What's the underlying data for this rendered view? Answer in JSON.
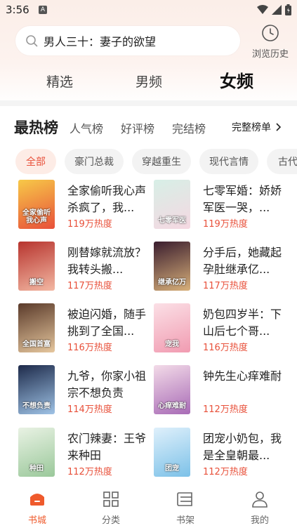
{
  "status": {
    "time": "3:56",
    "notif_badge": "A"
  },
  "search": {
    "query": "男人三十：妻子的欲望"
  },
  "history": {
    "label": "浏览历史"
  },
  "tabs": [
    {
      "label": "精选"
    },
    {
      "label": "男频"
    },
    {
      "label": "女频"
    }
  ],
  "ranking": {
    "title": "最热榜",
    "tabs": [
      "人气榜",
      "好评榜",
      "完结榜"
    ],
    "full_list_label": "完整榜单"
  },
  "chips": [
    "全部",
    "豪门总裁",
    "穿越重生",
    "现代言情",
    "古代"
  ],
  "books": [
    {
      "title": "全家偷听我心声杀疯了，我...",
      "heat": "119万热度",
      "cover_colors": [
        "#f7c948",
        "#e8503a"
      ],
      "cover_text": "全家偷听我心声"
    },
    {
      "title": "七零军婚：娇娇军医一哭，...",
      "heat": "119万热度",
      "cover_colors": [
        "#d7efe6",
        "#f5d8e2"
      ],
      "cover_text": "七零军医"
    },
    {
      "title": "刚替嫁就流放？我转头搬...",
      "heat": "117万热度",
      "cover_colors": [
        "#b7342e",
        "#f3b8a3"
      ],
      "cover_text": "搬空"
    },
    {
      "title": "分手后，她藏起孕肚继承亿...",
      "heat": "117万热度",
      "cover_colors": [
        "#3a1d2e",
        "#d8b07a"
      ],
      "cover_text": "继承亿万"
    },
    {
      "title": "被迫闪婚，随手挑到了全国...",
      "heat": "116万热度",
      "cover_colors": [
        "#5a3a2a",
        "#e6c79e"
      ],
      "cover_text": "全国首富"
    },
    {
      "title": "奶包四岁半：下山后七个哥...",
      "heat": "116万热度",
      "cover_colors": [
        "#fbe0e6",
        "#f19bb1"
      ],
      "cover_text": "宠我"
    },
    {
      "title": "九爷，你家小祖宗不想负责",
      "heat": "114万热度",
      "cover_colors": [
        "#1d2a4a",
        "#9fc3e6"
      ],
      "cover_text": "不想负责"
    },
    {
      "title": "钟先生心痒难耐",
      "heat": "112万热度",
      "cover_colors": [
        "#f3dbe8",
        "#a86bb6"
      ],
      "cover_text": "心痒难耐"
    },
    {
      "title": "农门辣妻：王爷来种田",
      "heat": "112万热度",
      "cover_colors": [
        "#e9f2e4",
        "#9ac89a"
      ],
      "cover_text": "种田"
    },
    {
      "title": "团宠小奶包，我是全皇朝最...",
      "heat": "112万热度",
      "cover_colors": [
        "#dff0fb",
        "#7cc1e8"
      ],
      "cover_text": "团宠"
    }
  ],
  "bottom_nav": [
    {
      "label": "书城",
      "icon": "bookstore-icon",
      "active": true
    },
    {
      "label": "分类",
      "icon": "category-icon",
      "active": false
    },
    {
      "label": "书架",
      "icon": "bookshelf-icon",
      "active": false
    },
    {
      "label": "我的",
      "icon": "profile-icon",
      "active": false
    }
  ],
  "colors": {
    "accent": "#e8503a",
    "nav_active": "#ef5a2c"
  }
}
